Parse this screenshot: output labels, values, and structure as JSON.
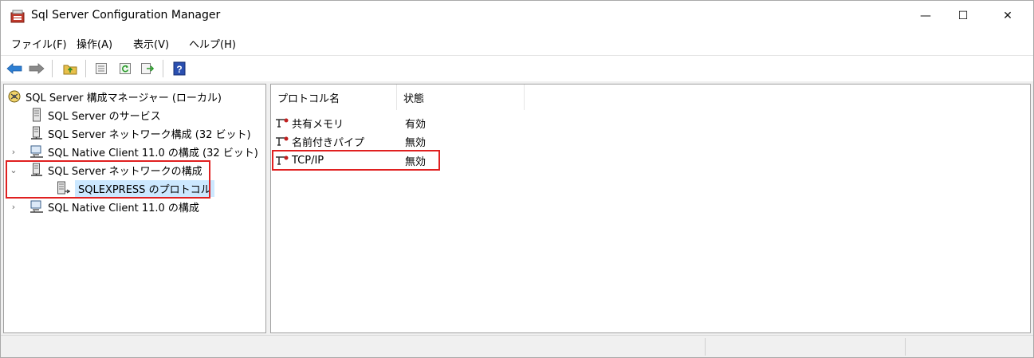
{
  "window": {
    "title": "Sql Server Configuration Manager",
    "minimize_glyph": "—",
    "maximize_glyph": "☐",
    "close_glyph": "✕"
  },
  "menu": [
    "ファイル(F)",
    "操作(A)",
    "表示(V)",
    "ヘルプ(H)"
  ],
  "toolbar": {
    "icons": [
      "back-arrow-icon",
      "forward-arrow-icon",
      "up-folder-icon",
      "properties-icon",
      "refresh-icon",
      "export-list-icon",
      "help-icon"
    ],
    "help_glyph": "?"
  },
  "tree": {
    "root": "SQL Server 構成マネージャー (ローカル)",
    "items": [
      {
        "label": "SQL Server のサービス",
        "toggle": ""
      },
      {
        "label": "SQL Server ネットワーク構成 (32 ビット)",
        "toggle": ""
      },
      {
        "label": "SQL Native Client 11.0 の構成 (32 ビット)",
        "toggle": "›"
      },
      {
        "label": "SQL Server ネットワークの構成",
        "toggle": "⌄"
      },
      {
        "label": "SQLEXPRESS のプロトコル",
        "toggle": ""
      },
      {
        "label": "SQL Native Client 11.0 の構成",
        "toggle": "›"
      }
    ]
  },
  "list": {
    "columns": [
      "プロトコル名",
      "状態"
    ],
    "rows": [
      {
        "name": "共有メモリ",
        "status": "有効"
      },
      {
        "name": "名前付きパイプ",
        "status": "無効"
      },
      {
        "name": "TCP/IP",
        "status": "無効"
      }
    ]
  },
  "colors": {
    "highlight_border": "#e02020",
    "selection_bg": "#cce8ff",
    "accent_blue": "#1e6fd9"
  }
}
